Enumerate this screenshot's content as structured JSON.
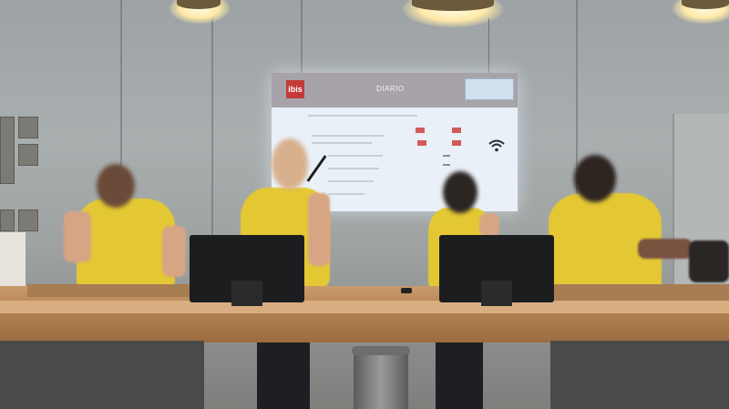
{
  "scene": {
    "description_tags": [
      "hotel-reception",
      "staff",
      "counter"
    ],
    "colors": {
      "shirt": "#e3c834",
      "counter": "#b68554",
      "wall": "#a9aeaf",
      "screen": "#e9f0f7",
      "brand_red": "#c43a3a"
    }
  },
  "screen": {
    "logo_text": "ibis",
    "title_text": "DIARIO"
  },
  "icons": {
    "wifi": "wifi-icon"
  }
}
